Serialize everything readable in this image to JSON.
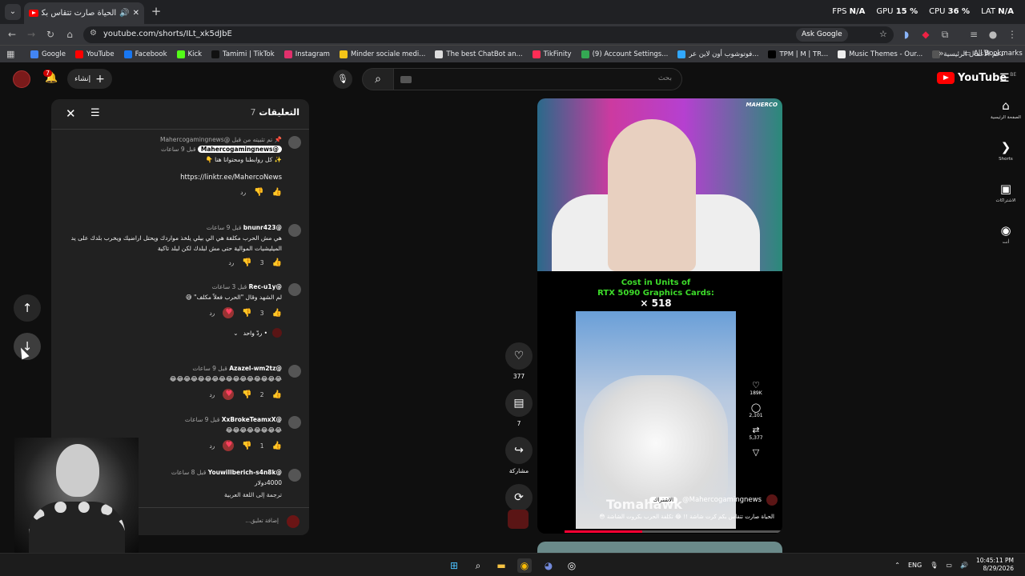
{
  "browser": {
    "tab_title": "الحياة صارت تتقاس بكم ك (7)",
    "url": "youtube.com/shorts/ILt_xk5dJbE",
    "ask_google": "Ask Google",
    "stats": {
      "fps_label": "FPS",
      "fps": "N/A",
      "gpu_label": "GPU",
      "gpu": "15 %",
      "cpu_label": "CPU",
      "cpu": "36 %",
      "lat_label": "LAT",
      "lat": "N/A"
    },
    "bookmarks": [
      {
        "label": "Google",
        "color": "#4285f4"
      },
      {
        "label": "YouTube",
        "color": "#ff0000"
      },
      {
        "label": "Facebook",
        "color": "#1877f2"
      },
      {
        "label": "Kick",
        "color": "#53fc18"
      },
      {
        "label": "Tamimi | TikTok",
        "color": "#111111"
      },
      {
        "label": "Instagram",
        "color": "#e1306c"
      },
      {
        "label": "Minder sociale medi...",
        "color": "#f5c518"
      },
      {
        "label": "The best ChatBot an...",
        "color": "#dddddd"
      },
      {
        "label": "TikFinity",
        "color": "#ff2d55"
      },
      {
        "label": "(9) Account Settings...",
        "color": "#34a853"
      },
      {
        "label": "فوتوشوب أون لاين عر...",
        "color": "#31a8ff"
      },
      {
        "label": "ꓔꓑꓟ | ꓟ | ꓔꓣ...",
        "color": "#000000"
      },
      {
        "label": "Music Themes - Our...",
        "color": "#eeeeee"
      },
      {
        "label": "دعم الأعمال الرئيسية",
        "color": "#555555"
      }
    ],
    "all_bookmarks": "All Bookmarks"
  },
  "yt_header": {
    "notif_count": "7",
    "create_label": "إنشاء",
    "search_placeholder": "بحث",
    "logo": "YouTube",
    "region": "BE"
  },
  "right_nav": [
    {
      "label": "الصفحة الرئيسية",
      "icon": "home-icon",
      "glyph": "⌂"
    },
    {
      "label": "Shorts",
      "icon": "shorts-icon",
      "glyph": "❯"
    },
    {
      "label": "الاشتراكات",
      "icon": "subscriptions-icon",
      "glyph": "▣"
    },
    {
      "label": "أنت",
      "icon": "you-icon",
      "glyph": "◉"
    }
  ],
  "comments": {
    "title": "التعليقات",
    "count": "7",
    "add_placeholder": "إضافة تعليق...",
    "reply_label": "رد",
    "items": [
      {
        "pinned": "تم تثبيته من قبل @Mahercogamingnews",
        "author": "@Mahercogamingnews",
        "time": "قبل 9 ساعات",
        "text": "✨ كل روابطنا ومحتوانا هنا 👇",
        "link": "https://linktr.ee/MahercoNews",
        "likes": ""
      },
      {
        "author": "@bnunr423",
        "time": "قبل 9 ساعات",
        "text": "هي مش الحرب مكلفة هي الي بيلي يلخذ مواردك ويحتل اراضيك ويخرب بلدك على يد الميليشيات الموالية حتى مش لبلدك لكن لبلد تاكية",
        "likes": "3"
      },
      {
        "author": "@Rec-u1y",
        "time": "قبل 3 ساعات",
        "text": "لم الشهد وقال \"الحرب فعلاً مكلف\" 😅",
        "likes": "3",
        "replies": "• ردّ واحد"
      },
      {
        "author": "@Azazel-wm2tz",
        "time": "قبل 9 ساعات",
        "text": "😂😂😂😂😂😂😂😂😂😂😂😂😂😂😂😂",
        "likes": "2"
      },
      {
        "author": "@XxBrokeTeamxX",
        "time": "قبل 9 ساعات",
        "text": "😂😂😂😂😂😂😂😂",
        "likes": "1"
      },
      {
        "author": "@Youwillberich-s4n8k",
        "time": "قبل 8 ساعات",
        "text": "4000دولار",
        "translate": "ترجمة إلى اللغة العربية",
        "likes": ""
      }
    ]
  },
  "short": {
    "streamer_logo": "MAHERCO",
    "cost_line1": "Cost in Units of",
    "cost_line2": "RTX 5090 Graphics Cards:",
    "cost_value": "× 518",
    "overlay_text": "Tomahawk",
    "likes_inner": "189K",
    "comments_inner": "2,101",
    "shares_inner": "5,377",
    "channel": "@Mahercogamingnews",
    "subscribe": "الاشتراك",
    "caption": "الحياة صارت تتقاس بكم كرت شاشة !! 😂 تكلفة الحرب بكروت الشاشة 😳",
    "progress": 0.36
  },
  "actions": {
    "likes": "377",
    "comments": "7",
    "share": "مشاركة",
    "remix": "ريمكس"
  },
  "taskbar": {
    "lang": "ENG",
    "time": "10:45:11 PM",
    "date": "8/29/2026"
  }
}
